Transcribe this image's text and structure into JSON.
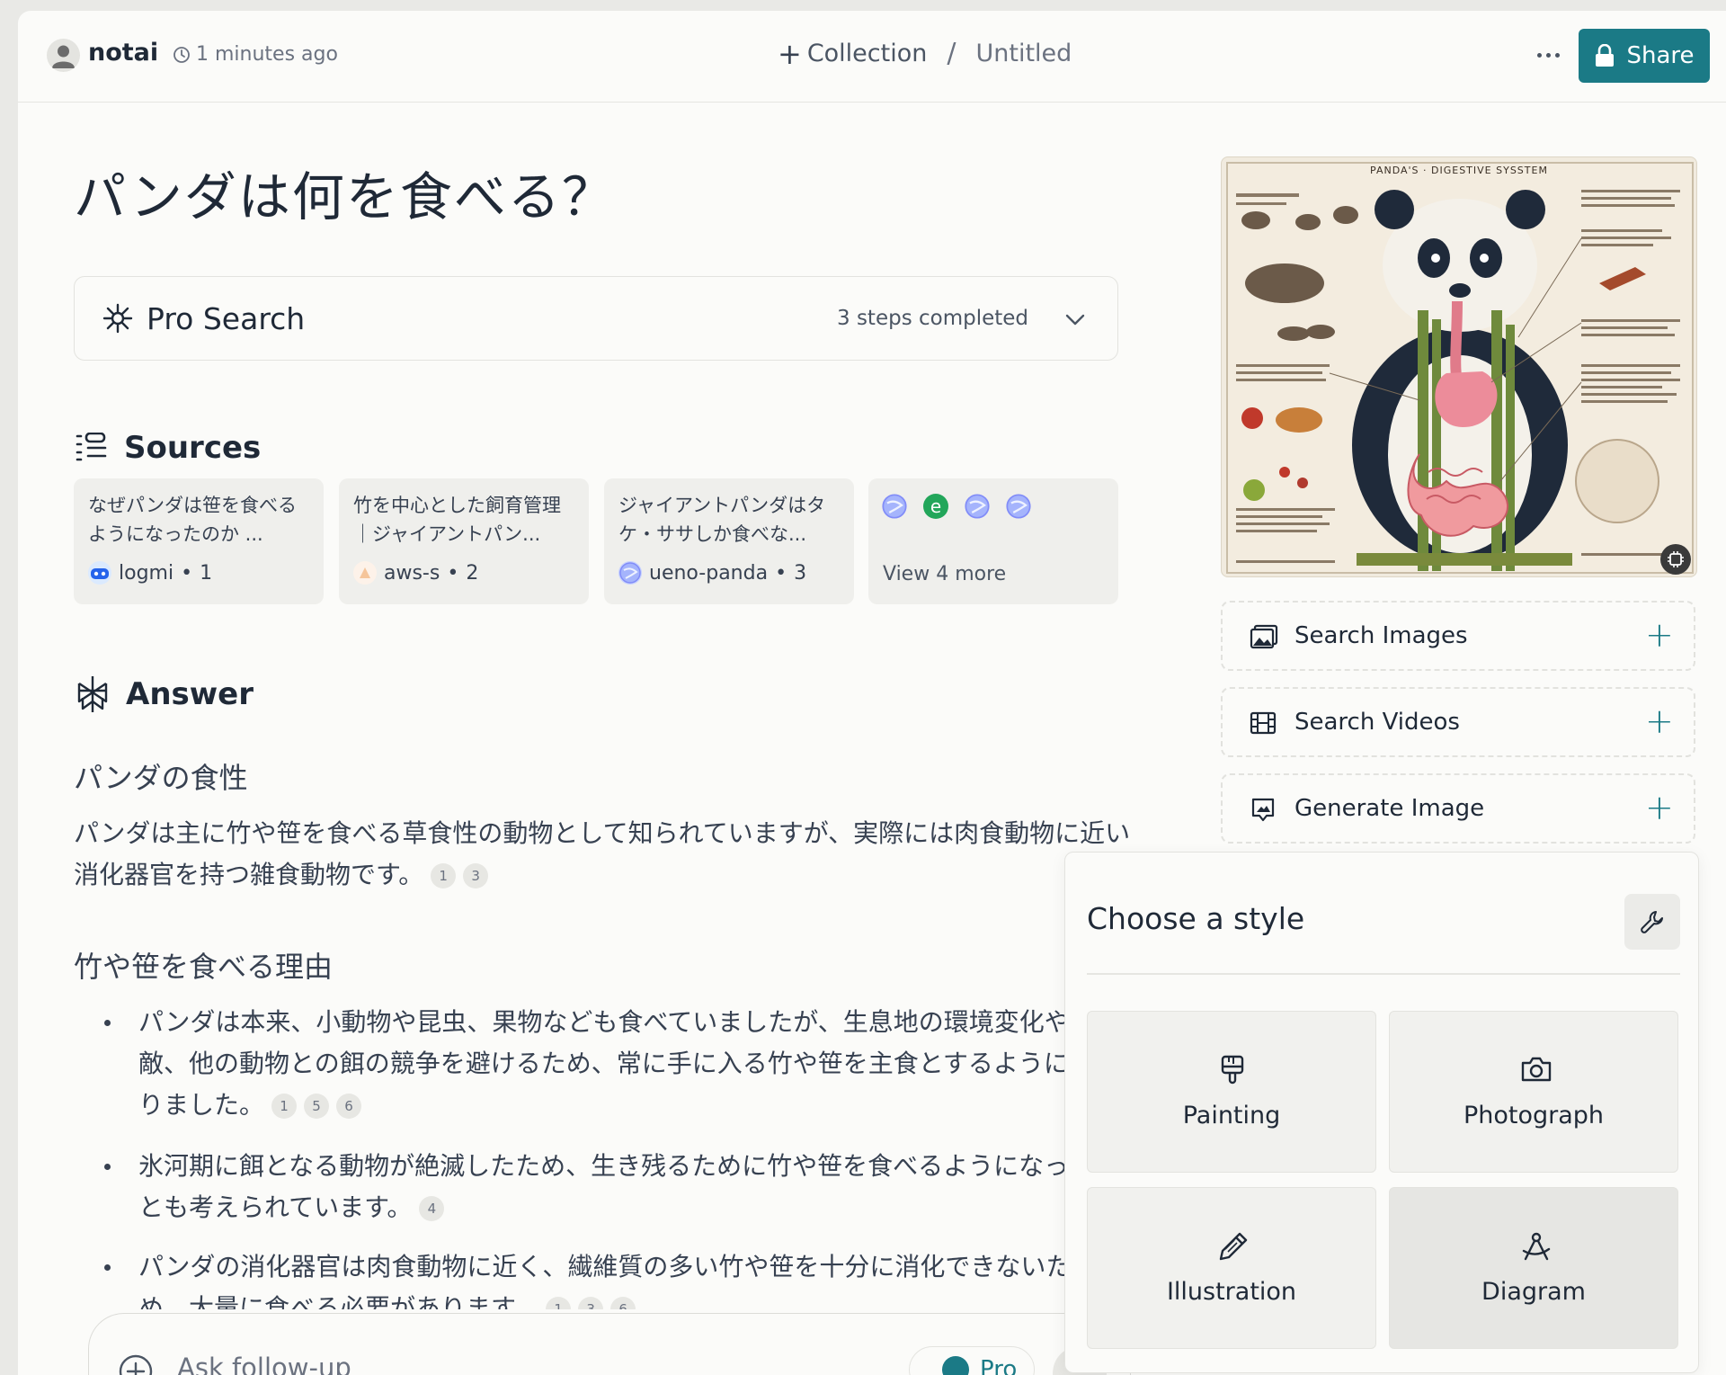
{
  "header": {
    "username": "notai",
    "time_ago": "1 minutes ago",
    "collection_label": "Collection",
    "separator": "/",
    "doc_title": "Untitled",
    "share_label": "Share"
  },
  "thread": {
    "title": "パンダは何を食べる？",
    "pro_search": {
      "label": "Pro Search",
      "status": "3 steps completed"
    },
    "sources_heading": "Sources",
    "sources": [
      {
        "text": "なぜパンダは笹を食べるようになったのか ...",
        "site": "logmi",
        "index": "1"
      },
      {
        "text": "竹を中心とした飼育管理｜ジャイアントパン...",
        "site": "aws-s",
        "index": "2"
      },
      {
        "text": "ジャイアントパンダはタケ・ササしか食べな...",
        "site": "ueno-panda",
        "index": "3"
      }
    ],
    "view_more": "View 4 more",
    "answer_heading": "Answer",
    "sec1_heading": "パンダの食性",
    "sec1_text": "パンダは主に竹や笹を食べる草食性の動物として知られていますが、実際には肉食動物に近い消化器官を持つ雑食動物です。",
    "sec1_cites": [
      "1",
      "3"
    ],
    "sec2_heading": "竹や笹を食べる理由",
    "bullets": [
      {
        "text": "パンダは本来、小動物や昆虫、果物なども食べていましたが、生息地の環境変化や天敵、他の動物との餌の競争を避けるため、常に手に入る竹や笹を主食とするようになりました。",
        "cites": [
          "1",
          "5",
          "6"
        ]
      },
      {
        "text": "氷河期に餌となる動物が絶滅したため、生き残るために竹や笹を食べるようになったとも考えられています。",
        "cites": [
          "4"
        ]
      },
      {
        "text": "パンダの消化器官は肉食動物に近く、繊維質の多い竹や笹を十分に消化できないため、大量に食べる必要があります。",
        "cites": [
          "1",
          "3",
          "6"
        ]
      }
    ],
    "followup_placeholder": "Ask follow-up",
    "pro_toggle_label": "Pro"
  },
  "sidebar": {
    "image_title": "PANDA'S · DIGESTIVE SYSSTEM",
    "actions": [
      {
        "label": "Search Images",
        "icon": "image-icon"
      },
      {
        "label": "Search Videos",
        "icon": "film-icon"
      },
      {
        "label": "Generate Image",
        "icon": "generate-image-icon"
      }
    ]
  },
  "style_popup": {
    "title": "Choose a style",
    "options": [
      {
        "label": "Painting",
        "icon": "paintbrush-icon"
      },
      {
        "label": "Photograph",
        "icon": "camera-icon"
      },
      {
        "label": "Illustration",
        "icon": "pencil-icon"
      },
      {
        "label": "Diagram",
        "icon": "compass-icon"
      }
    ],
    "selected": "Diagram"
  },
  "colors": {
    "accent": "#1b7a86",
    "background": "#fbfbf9",
    "card": "#efefec"
  }
}
